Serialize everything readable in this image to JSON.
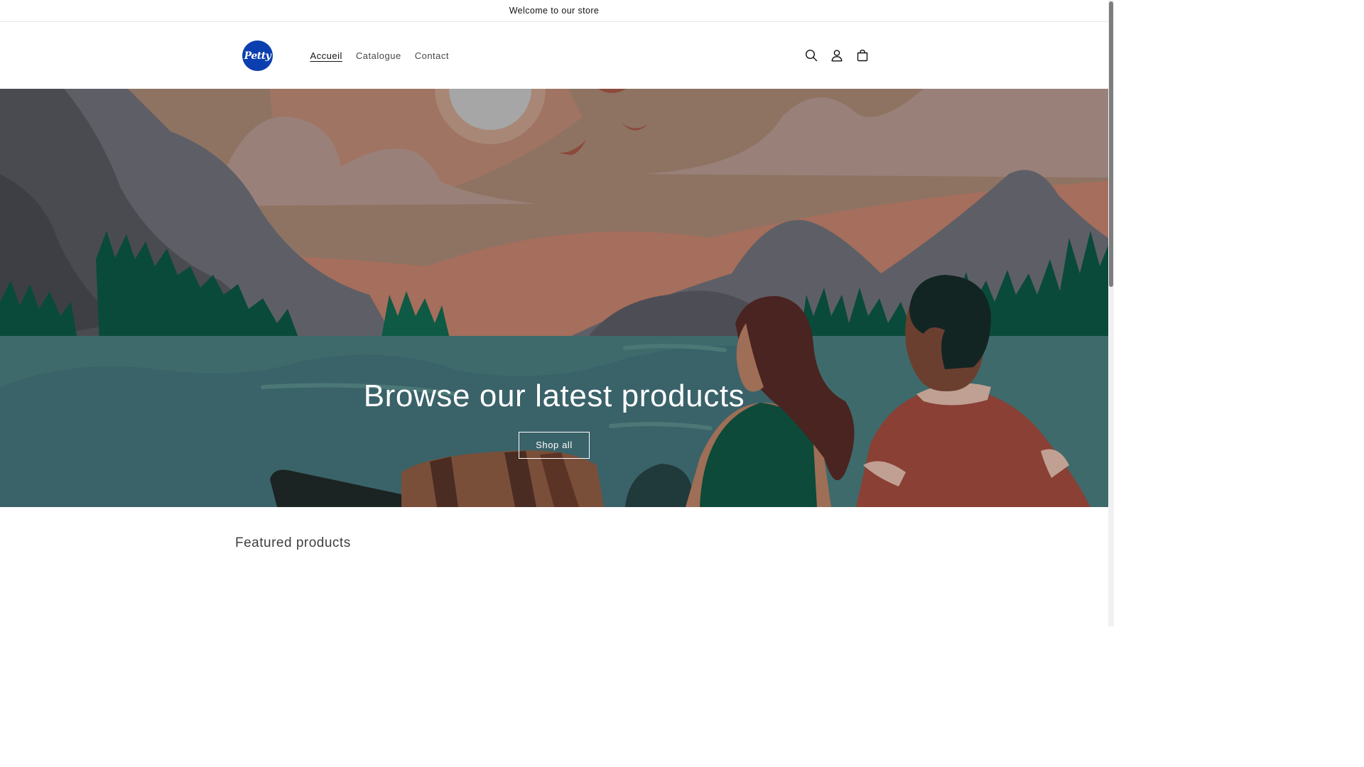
{
  "announcement": {
    "text": "Welcome to our store"
  },
  "header": {
    "logo_text": "Petty",
    "nav": [
      {
        "label": "Accueil",
        "active": true
      },
      {
        "label": "Catalogue",
        "active": false
      },
      {
        "label": "Contact",
        "active": false
      }
    ],
    "icons": [
      "search-icon",
      "account-icon",
      "cart-icon"
    ]
  },
  "hero": {
    "title": "Browse our latest products",
    "button_label": "Shop all"
  },
  "featured": {
    "title": "Featured products"
  },
  "colors": {
    "logo_blue": "#0b3fb0",
    "sky": "#8e7363",
    "water": "#3e6a6b",
    "forest": "#0a4a3a"
  }
}
